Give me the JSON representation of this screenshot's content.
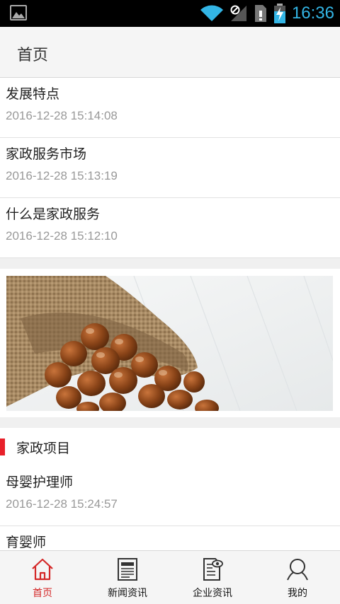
{
  "status_bar": {
    "time": "16:36"
  },
  "header": {
    "title": "首页"
  },
  "news": [
    {
      "title": "发展特点",
      "date": "2016-12-28 15:14:08"
    },
    {
      "title": "家政服务市场",
      "date": "2016-12-28 15:13:19"
    },
    {
      "title": "什么是家政服务",
      "date": "2016-12-28 15:12:10"
    }
  ],
  "section": {
    "title": "家政项目",
    "items": [
      {
        "title": "母婴护理师",
        "date": "2016-12-28 15:24:57"
      },
      {
        "title": "育婴师",
        "date": ""
      }
    ]
  },
  "tabs": [
    {
      "label": "首页",
      "icon": "home-icon",
      "active": true
    },
    {
      "label": "新闻资讯",
      "icon": "newspaper-icon",
      "active": false
    },
    {
      "label": "企业资讯",
      "icon": "company-info-icon",
      "active": false
    },
    {
      "label": "我的",
      "icon": "user-icon",
      "active": false
    }
  ],
  "colors": {
    "accent": "#d42727",
    "section_bar": "#e8202a",
    "clock": "#33b5e5"
  }
}
